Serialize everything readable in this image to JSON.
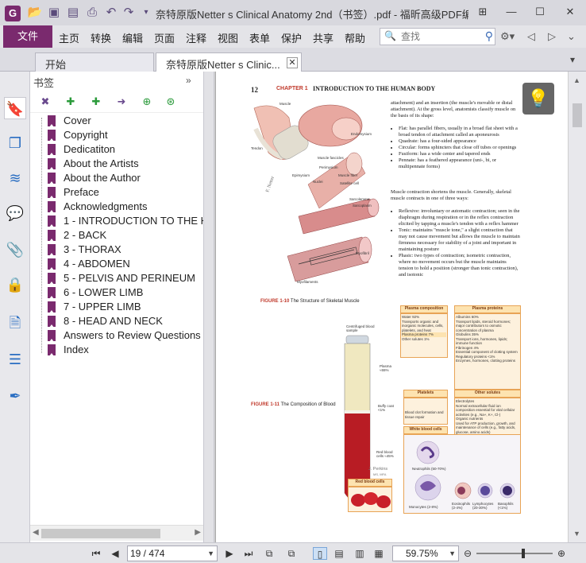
{
  "titlebar": {
    "title": "奈特原版Netter s Clinical Anatomy 2nd（书签）.pdf - 福昕高级PDF编...",
    "app_logo": "G",
    "quick_access_icons": [
      "open-folder-icon",
      "save-icon",
      "save-as-icon",
      "print-icon",
      "undo-icon",
      "redo-icon",
      "customize-icon"
    ],
    "window_buttons": [
      "restore-grid-icon",
      "minimize-icon",
      "maximize-icon",
      "close-icon"
    ]
  },
  "menubar": {
    "file_label": "文件",
    "items": [
      "主页",
      "转换",
      "编辑",
      "页面",
      "注释",
      "视图",
      "表单",
      "保护",
      "共享",
      "帮助"
    ],
    "search_placeholder": "查找"
  },
  "tabs": {
    "start_label": "开始",
    "doc_label": "奈特原版Netter s Clinic..."
  },
  "bookmarks": {
    "panel_title": "书签",
    "items": [
      {
        "label": "Cover"
      },
      {
        "label": "Copyright"
      },
      {
        "label": "Dedicatiton"
      },
      {
        "label": "About the Artists"
      },
      {
        "label": "About the Author"
      },
      {
        "label": "Preface"
      },
      {
        "label": "Acknowledgments"
      },
      {
        "label": "1 - INTRODUCTION TO THE HU"
      },
      {
        "label": "2 - BACK"
      },
      {
        "label": "3 - THORAX"
      },
      {
        "label": "4 - ABDOMEN"
      },
      {
        "label": "5 - PELVIS AND PERINEUM"
      },
      {
        "label": "6 - LOWER LIMB"
      },
      {
        "label": "7 - UPPER LIMB"
      },
      {
        "label": "8 - HEAD AND NECK"
      },
      {
        "label": "Answers to Review Questions"
      },
      {
        "label": "Index"
      }
    ]
  },
  "page": {
    "page_number": "12",
    "chapter": "CHAPTER 1",
    "chapter_title": "INTRODUCTION TO THE HUMAN BODY",
    "para1": "attachment) and an insertion (the muscle's movable or distal attachment). At the gross level, anatomists classify muscle on the basis of its shape:",
    "shape_list": [
      "Flat: has parallel fibers, usually in a broad flat sheet with a broad tendon of attachment called an aponeurosis",
      "Quadrate: has a four-sided appearance",
      "Circular: forms sphincters that close off tubes or openings",
      "Fusiform: has a wide center and tapered ends",
      "Pennate: has a feathered appearance (uni-, bi, or multipennate forms)"
    ],
    "para2": "Muscle contraction shortens the muscle. Generally, skeletal muscle contracts in one of three ways:",
    "contraction_list": [
      "Reflexive: involuntary or automatic contraction; seen in the diaphragm during respiration or in the reflex contraction elicited by tapping a muscle's tendon with a reflex hammer",
      "Tonic: maintains \"muscle tone,\" a slight contraction that may not cause movement but allows the muscle to maintain firmness necessary for stability of a joint and important in maintaining posture",
      "Phasic: two types of contraction; isometric contraction, where no movement occurs but the muscle maintains tension to hold a position (stronger than tonic contraction), and isotonic"
    ],
    "fig10_num": "FIGURE 1-10",
    "fig10_title": "The Structure of Skeletal Muscle",
    "fig11_num": "FIGURE 1-11",
    "fig11_title": "The Composition of Blood",
    "muscle_labels": [
      "Muscle",
      "Tendon",
      "Endomysium",
      "Muscle fascicles",
      "Perimysium",
      "Epimysium",
      "Muscle fiber",
      "Nuclei",
      "Satellite cell",
      "Sarcolemma",
      "Sarcoplasm",
      "Myofibril",
      "Myofilaments"
    ],
    "blood_labels": [
      "Centrifuged blood sample",
      "Plasma ≈55%",
      "Buffy coat <1%",
      "Red blood cells ≈45%"
    ],
    "plasma_comp": {
      "head": "Plasma composition",
      "rows": [
        "Water 92%",
        "Transports organic and inorganic molecules, cells, platelets, and heat",
        "Plasma proteins 7%",
        "Other solutes 1%"
      ]
    },
    "plasma_proteins": {
      "head": "Plasma proteins",
      "rows": [
        "Albumins 60%",
        "Transport lipids, steroid hormones; major contributors to osmotic concentration of plasma",
        "Globulins 35%",
        "Transport ions, hormones, lipids; immune function",
        "Fibrinogen 4%",
        "Essential component of clotting system",
        "Regulatory proteins <1%",
        "Enzymes, hormones, clotting proteins"
      ]
    },
    "platelets": {
      "head": "Platelets",
      "rows": [
        "Blood clot formation and tissue repair"
      ]
    },
    "other_solutes": {
      "head": "Other solutes",
      "rows": [
        "Electrolytes",
        "Normal extracellular fluid ion composition essential for vital cellular activities (e.g., Na+, K+, Cl-)",
        "Organic nutrients",
        "Used for ATP production, growth, and maintenance of cells (e.g., fatty acids, glucose, amino acids)",
        "Organic wastes",
        "Carried to sites of breakdown or excretion (e.g., urea, bilirubin)"
      ]
    },
    "wbc": {
      "head": "White blood cells",
      "cells": [
        "Neutrophils (50-70%)",
        "Monocytes (2-8%)",
        "Eosinophils (2-4%)",
        "Lymphocytes (20-30%)",
        "Basophils (<1%)"
      ]
    },
    "rbc_label": "Red blood cells",
    "artist_sig": "J. Perkins",
    "artist_sig_sub": "MS, MFA",
    "netter_sig": "F. Netter"
  },
  "statusbar": {
    "page_display": "19 / 474",
    "zoom_display": "59.75%",
    "zoom_level_fraction": 0.62
  },
  "colors": {
    "brand": "#7a2a6e",
    "chapter_red": "#c0392b",
    "box_orange": "#e8a456"
  }
}
